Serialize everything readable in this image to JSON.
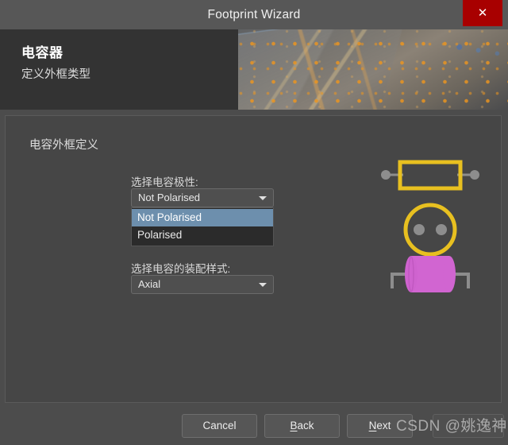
{
  "window": {
    "title": "Footprint Wizard",
    "close_label": "✕"
  },
  "banner": {
    "title": "电容器",
    "subtitle": "定义外框类型",
    "image_name": "pcb-photo"
  },
  "content": {
    "section_label": "电容外框定义",
    "fields": [
      {
        "label": "选择电容极性:",
        "value": "Not Polarised",
        "expanded": true,
        "options": [
          {
            "label": "Not Polarised",
            "selected": true
          },
          {
            "label": "Polarised",
            "selected": false
          }
        ]
      },
      {
        "label": "选择电容的装配样式:",
        "value": "Axial",
        "expanded": false,
        "options": [
          {
            "label": "Axial",
            "selected": true
          }
        ]
      }
    ],
    "preview": {
      "footprint_outline_name": "capacitor-footprint-outline",
      "pad_shape_name": "capacitor-round-pad-preview",
      "body_name": "axial-capacitor-body-preview",
      "outline_color": "#e8c020",
      "pad_color": "#8d8d8d",
      "body_color": "#d165d1",
      "lead_color": "#8d8d8d"
    }
  },
  "footer": {
    "buttons": [
      {
        "name": "cancel-button",
        "label": "Cancel",
        "enabled": true
      },
      {
        "name": "back-button",
        "label": "Back",
        "enabled": true
      },
      {
        "name": "next-button",
        "label": "Next",
        "enabled": true
      },
      {
        "name": "finish-button",
        "label": "",
        "enabled": false
      }
    ]
  },
  "watermark": {
    "text": "CSDN @姚逸神"
  },
  "colors": {
    "window_bg": "#4c4c4c",
    "titlebar": "#575757",
    "close_red": "#a80000",
    "panel": "#464646",
    "banner_bg": "#333333",
    "highlight_blue": "#6d8fad",
    "dropdown_bg": "#2b2b2b",
    "accent_yellow": "#e8c020",
    "capacitor_pink": "#d165d1"
  }
}
